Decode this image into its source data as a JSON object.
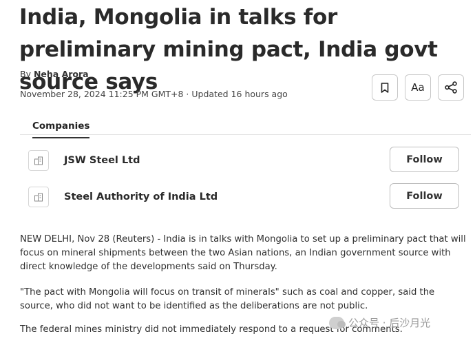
{
  "article": {
    "headline": "India, Mongolia in talks for preliminary mining pact, India govt source says",
    "byline_prefix": "By",
    "author": "Neha Arora",
    "dateline": "November 28, 2024 11:25 PM GMT+8 · Updated 16 hours ago"
  },
  "actions": {
    "bookmark_icon": "bookmark-icon",
    "text_size_label": "Aa",
    "share_icon": "share-icon"
  },
  "companies": {
    "tab_label": "Companies",
    "items": [
      {
        "name": "JSW Steel Ltd",
        "follow_label": "Follow",
        "icon": "building-icon"
      },
      {
        "name": "Steel Authority of India Ltd",
        "follow_label": "Follow",
        "icon": "building-icon"
      }
    ]
  },
  "paragraphs": [
    "NEW DELHI, Nov 28 (Reuters) - India is in talks with Mongolia to set up a preliminary pact that will focus on mineral shipments between the two Asian nations, an Indian government source with direct knowledge of the developments said on Thursday.",
    "\"The pact with Mongolia will focus on transit of minerals\" such as coal and copper, said the source, who did not want to be identified as the deliberations are not public.",
    "The federal mines ministry did not immediately respond to a request for comments."
  ],
  "watermark": {
    "text": "公众号 · 后沙月光"
  }
}
